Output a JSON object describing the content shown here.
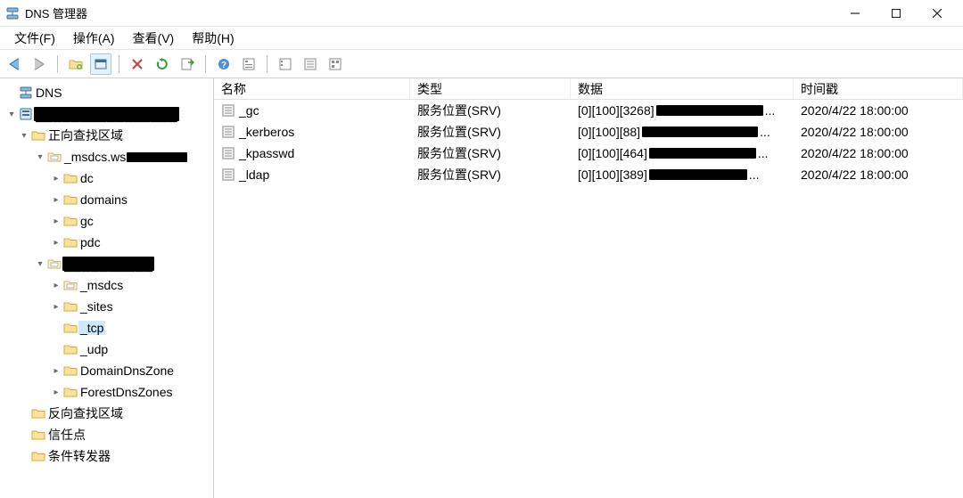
{
  "window": {
    "title": "DNS 管理器"
  },
  "menu": {
    "file": "文件(F)",
    "action": "操作(A)",
    "view": "查看(V)",
    "help": "帮助(H)"
  },
  "tree": {
    "root": "DNS",
    "server_redacted": "████████████████",
    "fwd_zones": "正向查找区域",
    "msdcs_zone_partial": "_msdcs.ws",
    "dc": "dc",
    "domains": "domains",
    "gc": "gc",
    "pdc": "pdc",
    "zone2_redacted": "██████████",
    "_msdcs": "_msdcs",
    "_sites": "_sites",
    "_tcp": "_tcp",
    "_udp": "_udp",
    "domain_dns_zones": "DomainDnsZone",
    "forest_dns_zones": "ForestDnsZones",
    "rev_zones": "反向查找区域",
    "trust_points": "信任点",
    "cond_fwd": "条件转发器"
  },
  "columns": {
    "name": "名称",
    "type": "类型",
    "data": "数据",
    "timestamp": "时间戳"
  },
  "records": {
    "r0": {
      "name": "_gc",
      "type": "服务位置(SRV)",
      "data_prefix": "[0][100][3268]",
      "ts": "2020/4/22 18:00:00"
    },
    "r1": {
      "name": "_kerberos",
      "type": "服务位置(SRV)",
      "data_prefix": "[0][100][88]",
      "ts": "2020/4/22 18:00:00"
    },
    "r2": {
      "name": "_kpasswd",
      "type": "服务位置(SRV)",
      "data_prefix": "[0][100][464]",
      "ts": "2020/4/22 18:00:00"
    },
    "r3": {
      "name": "_ldap",
      "type": "服务位置(SRV)",
      "data_prefix": "[0][100][389]",
      "ts": "2020/4/22 18:00:00"
    }
  }
}
